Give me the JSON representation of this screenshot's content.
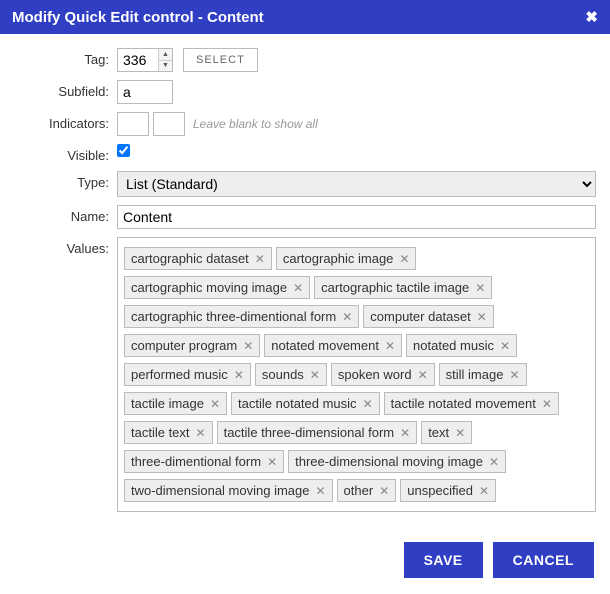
{
  "title": "Modify Quick Edit control - Content",
  "close_glyph": "✖",
  "labels": {
    "tag": "Tag:",
    "subfield": "Subfield:",
    "indicators": "Indicators:",
    "visible": "Visible:",
    "type": "Type:",
    "name": "Name:",
    "values": "Values:"
  },
  "fields": {
    "tag_value": "336",
    "select_button": "SELECT",
    "subfield_value": "a",
    "indicator1": "",
    "indicator2": "",
    "indicator_hint": "Leave blank to show all",
    "visible_checked": true,
    "type_value": "List (Standard)",
    "name_value": "Content"
  },
  "values": [
    "cartographic dataset",
    "cartographic image",
    "cartographic moving image",
    "cartographic tactile image",
    "cartographic three-dimentional form",
    "computer dataset",
    "computer program",
    "notated movement",
    "notated music",
    "performed music",
    "sounds",
    "spoken word",
    "still image",
    "tactile image",
    "tactile notated music",
    "tactile notated movement",
    "tactile text",
    "tactile three-dimensional form",
    "text",
    "three-dimentional form",
    "three-dimensional moving image",
    "two-dimensional moving image",
    "other",
    "unspecified"
  ],
  "tag_remove_glyph": "✕",
  "buttons": {
    "save": "SAVE",
    "cancel": "CANCEL"
  }
}
